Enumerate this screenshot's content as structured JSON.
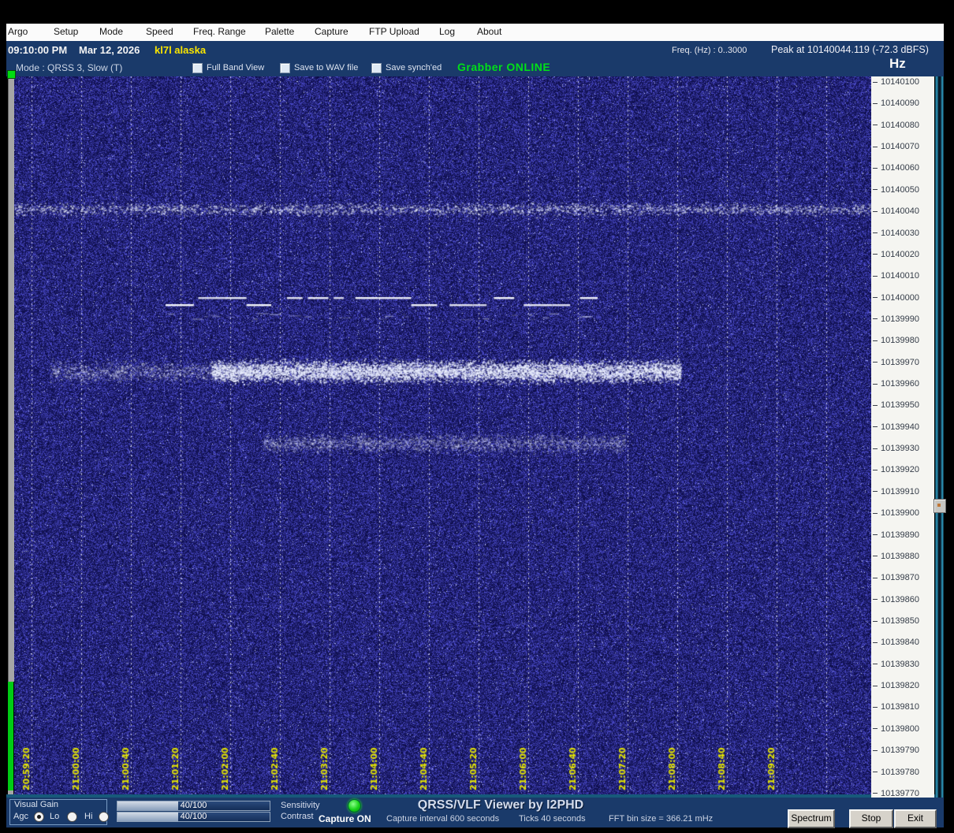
{
  "menu_bar": {
    "items": [
      "Argo",
      "Setup",
      "Mode",
      "Speed",
      "Freq. Range",
      "Palette",
      "Capture",
      "FTP Upload",
      "Log",
      "About"
    ]
  },
  "status_bar": {
    "time": "09:10:00 PM",
    "date": "Mar 12, 2026",
    "station": "kl7l alaska",
    "freq_range": "Freq. (Hz) :  0..3000",
    "peak": "Peak at 10140044.119 (-72.3 dBFS)"
  },
  "mode_bar": {
    "mode": "Mode : QRSS 3, Slow  (T)",
    "checkboxes": [
      {
        "label": "Full Band View",
        "checked": false
      },
      {
        "label": "Save to WAV file",
        "checked": false
      },
      {
        "label": "Save synch'ed",
        "checked": false
      }
    ],
    "grabber_status": "Grabber ONLINE",
    "grabber_color": "#00e018",
    "axis_unit": "Hz"
  },
  "spectrogram": {
    "background_color": "#10105c",
    "gridline_color": "#ffffff",
    "time_label_color": "#e6e600",
    "time_labels": [
      "20:59:20",
      "21:00:00",
      "21:00:40",
      "21:01:20",
      "21:02:00",
      "21:02:40",
      "21:03:20",
      "21:04:00",
      "21:04:40",
      "21:05:20",
      "21:06:00",
      "21:06:40",
      "21:07:20",
      "21:08:00",
      "21:08:40",
      "21:09:20"
    ],
    "signals": [
      {
        "name": "diffuse-band-top",
        "freq_hz": 10140042,
        "appearance": "faint speckled band, full width"
      },
      {
        "name": "qrss-fsk-cw-trace",
        "freq_hz": 10140000,
        "appearance": "bright stepped dashes (FSK CW keying)"
      },
      {
        "name": "dense-fuzzy-band",
        "freq_hz": 10139966,
        "appearance": "dense diffuse white band"
      },
      {
        "name": "faint-fuzzy-band",
        "freq_hz": 10139933,
        "appearance": "faint diffuse band"
      }
    ]
  },
  "freq_scale": {
    "labels": [
      "10140100",
      "10140090",
      "10140080",
      "10140070",
      "10140060",
      "10140050",
      "10140040",
      "10140030",
      "10140020",
      "10140010",
      "10140000",
      "10139990",
      "10139980",
      "10139970",
      "10139960",
      "10139950",
      "10139940",
      "10139930",
      "10139920",
      "10139910",
      "10139900",
      "10139890",
      "10139880",
      "10139870",
      "10139860",
      "10139850",
      "10139840",
      "10139830",
      "10139820",
      "10139810",
      "10139800",
      "10139790",
      "10139780",
      "10139770"
    ]
  },
  "bottom_bar": {
    "visual_gain": {
      "title": "Visual Gain",
      "options": [
        {
          "label": "Agc",
          "selected": true
        },
        {
          "label": "Lo",
          "selected": false
        },
        {
          "label": "Hi",
          "selected": false
        }
      ]
    },
    "sliders": [
      {
        "label": "Sensitivity",
        "value": "40/100",
        "percent": 40
      },
      {
        "label": "Contrast",
        "value": "40/100",
        "percent": 40
      }
    ],
    "led_color": "#16d016",
    "capture_status": "Capture ON",
    "app_title": "QRSS/VLF Viewer by I2PHD",
    "capture_interval": "Capture interval 600 seconds",
    "ticks_label": "Ticks  40 seconds",
    "fft_label": "FFT bin size = 366.21 mHz",
    "buttons": [
      "Spectrum",
      "Stop",
      "Exit"
    ]
  }
}
